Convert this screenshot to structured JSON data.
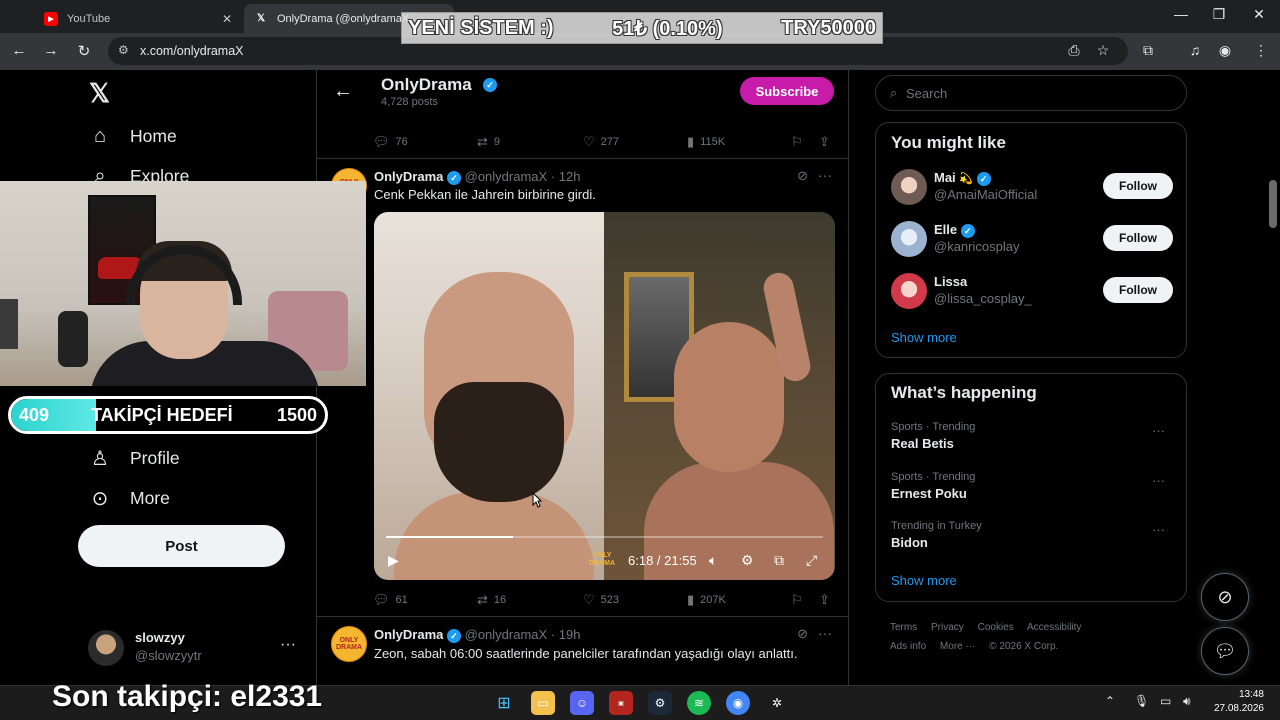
{
  "browser": {
    "tabs": [
      {
        "label": "YouTube",
        "icon": "youtube-icon"
      },
      {
        "label": "OnlyDrama (@onlydramaX",
        "icon": "x-logo-icon"
      }
    ],
    "url": "x.com/onlydramaX"
  },
  "overlay": {
    "banner_left": "YENİ SİSTEM :)",
    "banner_mid": "51₺ (0.10%)",
    "banner_right": "TRY50000",
    "goal_current": "409",
    "goal_label": "TAKİPÇİ HEDEFİ",
    "goal_target": "1500",
    "goal_progress": 0.27,
    "last_follower": "Son takipçi: el2331"
  },
  "nav": {
    "home": "Home",
    "explore": "Explore",
    "profile": "Profile",
    "more": "More",
    "post": "Post"
  },
  "account": {
    "name": "slowzyy",
    "handle": "@slowzyytr"
  },
  "profile": {
    "name": "OnlyDrama",
    "posts": "4,728 posts",
    "subscribe": "Subscribe"
  },
  "tweets": [
    {
      "replies": "76",
      "reposts": "9",
      "likes": "277",
      "views": "115K"
    },
    {
      "name": "OnlyDrama",
      "handle": "@onlydramaX · 12h",
      "text": "Cenk Pekkan ile Jahrein birbirine girdi.",
      "video_time": "6:18 / 21:55",
      "video_progress": 0.29,
      "replies": "61",
      "reposts": "16",
      "likes": "523",
      "views": "207K",
      "avatar_text": "ONLY DRAMA"
    },
    {
      "name": "OnlyDrama",
      "handle": "@onlydramaX · 19h",
      "text": "Zeon, sabah 06:00 saatlerinde panelciler tarafından yaşadığı olayı anlattı.",
      "avatar_text": "ONLY DRAMA"
    }
  ],
  "sidebar": {
    "search_placeholder": "Search",
    "might_like_title": "You might like",
    "suggestions": [
      {
        "name": "Mai",
        "handle": "@AmaiMaiOfficial",
        "follow": "Follow"
      },
      {
        "name": "Elle",
        "handle": "@kanricosplay",
        "follow": "Follow"
      },
      {
        "name": "Lissa",
        "handle": "@lissa_cosplay_",
        "follow": "Follow"
      }
    ],
    "show_more": "Show more",
    "happening_title": "What’s happening",
    "trends": [
      {
        "context": "Sports · Trending",
        "name": "Real Betis"
      },
      {
        "context": "Sports · Trending",
        "name": "Ernest Poku"
      },
      {
        "context": "Trending in Turkey",
        "name": "Bidon"
      }
    ],
    "footer": [
      "Terms",
      "Privacy",
      "Cookies",
      "Accessibility",
      "Ads info",
      "More ···",
      "© 2026 X Corp."
    ]
  },
  "taskbar": {
    "time": "13:48",
    "date": "27.08.2026"
  },
  "colors": {
    "subscribe": "#c91ba9",
    "verified": "#1d9bf0",
    "goal_fill": "#2ad4cf"
  }
}
